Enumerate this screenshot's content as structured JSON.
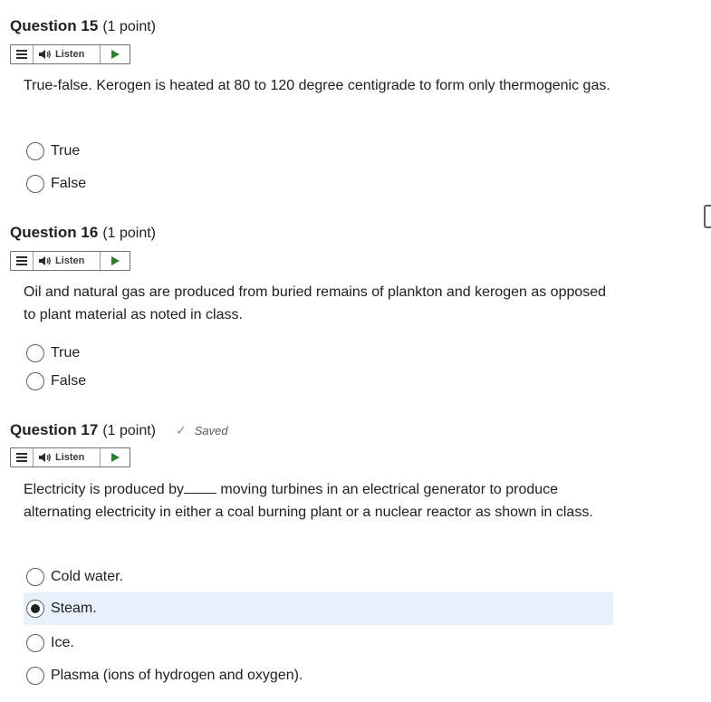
{
  "questions": [
    {
      "title": "Question 15",
      "points": "(1 point)",
      "listen_label": "Listen",
      "text": "True-false.  Kerogen is heated at 80 to 120 degree centigrade to form only thermogenic gas.",
      "options": [
        "True",
        "False"
      ],
      "selected_index": null
    },
    {
      "title": "Question 16",
      "points": "(1 point)",
      "listen_label": "Listen",
      "text": "Oil and natural gas are produced from buried remains of plankton and kerogen as opposed to plant material as noted in class.",
      "options": [
        "True",
        "False"
      ],
      "selected_index": null
    },
    {
      "title": "Question 17",
      "points": "(1 point)",
      "saved_label": "Saved",
      "listen_label": "Listen",
      "text_before_blank": "Electricity is produced by",
      "text_after_blank": " moving turbines in an electrical generator to produce alternating electricity in either a coal burning plant or a nuclear reactor as shown in class.",
      "options": [
        "Cold water.",
        "Steam.",
        "Ice.",
        "Plasma (ions of hydrogen and oxygen)."
      ],
      "selected_index": 1
    }
  ],
  "icons": {
    "menu": "hamburger-menu-icon",
    "speaker": "speaker-icon",
    "play": "play-icon",
    "check": "checkmark-icon",
    "side_handle": "side-panel-handle"
  },
  "colors": {
    "play_green": "#2e7d32",
    "selected_bg": "#e8f1fb",
    "text": "#202122"
  }
}
